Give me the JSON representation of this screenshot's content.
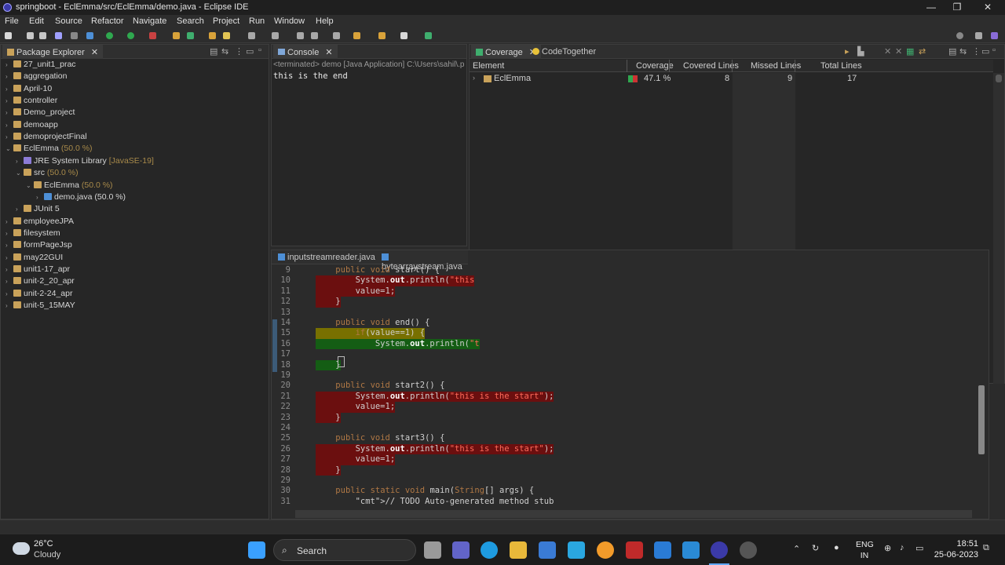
{
  "window": {
    "title": "springboot - EclEmma/src/EclEmma/demo.java - Eclipse IDE",
    "controls": [
      "—",
      "❐",
      "✕"
    ]
  },
  "menu": [
    "File",
    "Edit",
    "Source",
    "Refactor",
    "Navigate",
    "Search",
    "Project",
    "Run",
    "Window",
    "Help"
  ],
  "package_explorer": {
    "tab_label": "Package Explorer",
    "items": [
      {
        "label": "27_unit1_prac",
        "pct": "",
        "depth": 0,
        "arrow": "›"
      },
      {
        "label": "aggregation",
        "pct": "",
        "depth": 0,
        "arrow": "›"
      },
      {
        "label": "April-10",
        "pct": "",
        "depth": 0,
        "arrow": "›"
      },
      {
        "label": "controller",
        "pct": "",
        "depth": 0,
        "arrow": "›"
      },
      {
        "label": "Demo_project",
        "pct": "",
        "depth": 0,
        "arrow": "›"
      },
      {
        "label": "demoapp",
        "pct": "",
        "depth": 0,
        "arrow": "›"
      },
      {
        "label": "demoprojectFinal",
        "pct": "",
        "depth": 0,
        "arrow": "›"
      },
      {
        "label": "EclEmma",
        "pct": "(50.0 %)",
        "depth": 0,
        "arrow": "⌄"
      },
      {
        "label": "JRE System Library",
        "pct": "[JavaSE-19]",
        "depth": 1,
        "arrow": "›"
      },
      {
        "label": "src",
        "pct": "(50.0 %)",
        "depth": 1,
        "arrow": "⌄"
      },
      {
        "label": "EclEmma",
        "pct": "(50.0 %)",
        "depth": 2,
        "arrow": "⌄"
      },
      {
        "label": "demo.java (50.0 %)",
        "pct": "",
        "depth": 3,
        "arrow": "›"
      },
      {
        "label": "JUnit 5",
        "pct": "",
        "depth": 1,
        "arrow": "›"
      },
      {
        "label": "employeeJPA",
        "pct": "",
        "depth": 0,
        "arrow": "›"
      },
      {
        "label": "filesystem",
        "pct": "",
        "depth": 0,
        "arrow": "›"
      },
      {
        "label": "formPageJsp",
        "pct": "",
        "depth": 0,
        "arrow": "›"
      },
      {
        "label": "may22GUI",
        "pct": "",
        "depth": 0,
        "arrow": "›"
      },
      {
        "label": "unit1-17_apr",
        "pct": "",
        "depth": 0,
        "arrow": "›"
      },
      {
        "label": "unit-2_20_apr",
        "pct": "",
        "depth": 0,
        "arrow": "›"
      },
      {
        "label": "unit-2-24_apr",
        "pct": "",
        "depth": 0,
        "arrow": "›"
      },
      {
        "label": "unit-5_15MAY",
        "pct": "",
        "depth": 0,
        "arrow": "›"
      }
    ]
  },
  "console": {
    "tab_label": "Console",
    "header": "<terminated> demo [Java Application] C:\\Users\\sahil\\.p",
    "output": "this is the end"
  },
  "coverage": {
    "tab_label": "Coverage",
    "tab2_label": "CodeTogether",
    "columns": [
      "Element",
      "Coverage",
      "Covered Lines",
      "Missed Lines",
      "Total Lines"
    ],
    "rows": [
      {
        "element": "EclEmma",
        "coverage": "47.1 %",
        "covered": "8",
        "missed": "9",
        "total": "17",
        "covered_fraction": 0.471
      }
    ]
  },
  "editor": {
    "tabs": [
      "inputstreamreader.java",
      "bytearraystream.java"
    ],
    "lines": [
      {
        "n": "9",
        "hl": "",
        "text": "    public void start() {"
      },
      {
        "n": "10",
        "hl": "red",
        "text": "        System.out.println(\"this"
      },
      {
        "n": "11",
        "hl": "red",
        "text": "        value=1;"
      },
      {
        "n": "12",
        "hl": "red",
        "text": "    }"
      },
      {
        "n": "13",
        "hl": "",
        "text": ""
      },
      {
        "n": "14",
        "hl": "",
        "text": "    public void end() {"
      },
      {
        "n": "15",
        "hl": "yel",
        "text": "        if(value==1) {"
      },
      {
        "n": "16",
        "hl": "grn",
        "text": "            System.out.println(\"t"
      },
      {
        "n": "17",
        "hl": "",
        "text": ""
      },
      {
        "n": "18",
        "hl": "grn",
        "text": "    }"
      },
      {
        "n": "19",
        "hl": "",
        "text": ""
      },
      {
        "n": "20",
        "hl": "",
        "text": "    public void start2() {"
      },
      {
        "n": "21",
        "hl": "red",
        "text": "        System.out.println(\"this is the start\");"
      },
      {
        "n": "22",
        "hl": "red",
        "text": "        value=1;"
      },
      {
        "n": "23",
        "hl": "red",
        "text": "    }"
      },
      {
        "n": "24",
        "hl": "",
        "text": ""
      },
      {
        "n": "25",
        "hl": "",
        "text": "    public void start3() {"
      },
      {
        "n": "26",
        "hl": "red",
        "text": "        System.out.println(\"this is the start\");"
      },
      {
        "n": "27",
        "hl": "red",
        "text": "        value=1;"
      },
      {
        "n": "28",
        "hl": "red",
        "text": "    }"
      },
      {
        "n": "29",
        "hl": "",
        "text": ""
      },
      {
        "n": "30",
        "hl": "",
        "text": "    public static void main(String[] args) {"
      },
      {
        "n": "31",
        "hl": "",
        "text": "        // TODO Auto-generated method stub"
      }
    ]
  },
  "taskbar": {
    "weather_temp": "26°C",
    "weather_desc": "Cloudy",
    "search_label": "Search",
    "lang_top": "ENG",
    "lang_bottom": "IN",
    "time": "18:51",
    "date": "25-06-2023"
  },
  "colors": {
    "covered": "#145d14",
    "missed": "#6b0f0f",
    "partial": "#787000"
  }
}
